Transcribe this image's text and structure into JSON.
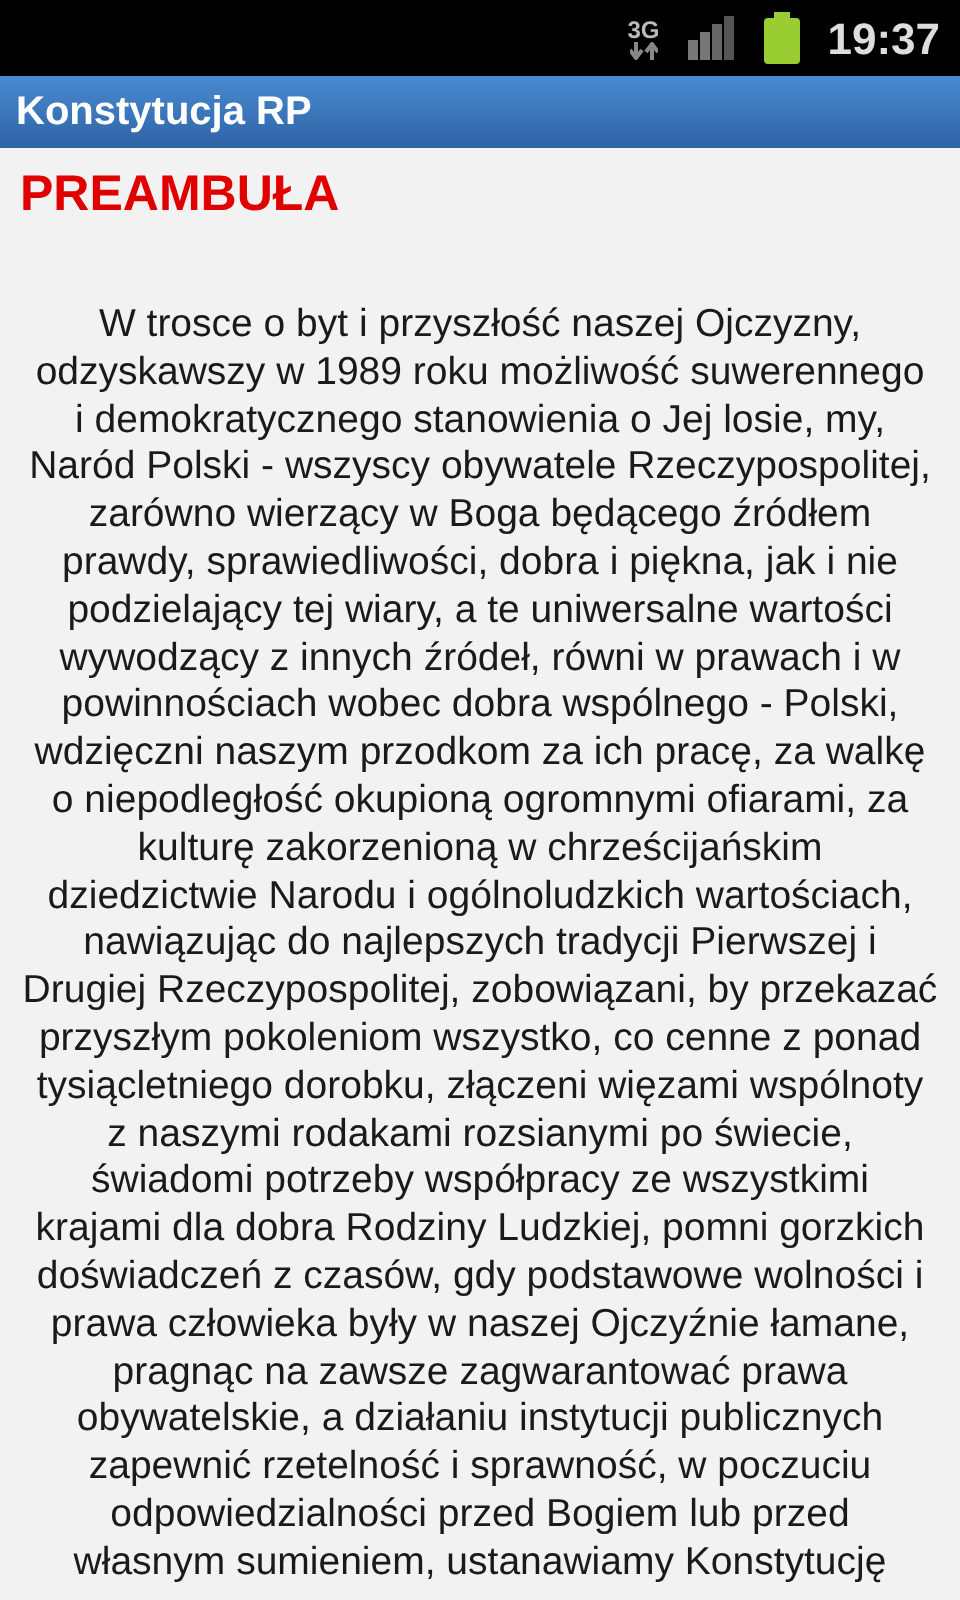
{
  "status_bar": {
    "network": "3G",
    "time": "19:37"
  },
  "window": {
    "title": "Konstytucja RP"
  },
  "heading": "PREAMBUŁA",
  "paragraph_lines": [
    "W trosce o byt i przyszłość naszej Ojczyzny,",
    "odzyskawszy w 1989 roku możliwość suwerennego",
    "i demokratycznego stanowienia o Jej losie, my,",
    "Naród Polski - wszyscy obywatele Rzeczypospolitej,",
    "zarówno wierzący w Boga będącego źródłem",
    "prawdy, sprawiedliwości, dobra i piękna, jak i nie",
    "podzielający tej wiary, a te uniwersalne wartości",
    "wywodzący z innych źródeł, równi w prawach i w",
    "powinnościach wobec dobra wspólnego - Polski,",
    "wdzięczni naszym przodkom za ich pracę, za walkę",
    "o niepodległość okupioną ogromnymi ofiarami, za",
    "kulturę zakorzenioną w chrześcijańskim",
    "dziedzictwie Narodu i ogólnoludzkich wartościach,",
    "nawiązując do najlepszych tradycji Pierwszej i",
    "Drugiej Rzeczypospolitej, zobowiązani, by przekazać",
    "przyszłym pokoleniom wszystko, co cenne z ponad",
    "tysiącletniego dorobku, złączeni więzami wspólnoty",
    "z naszymi rodakami rozsianymi po świecie,",
    "świadomi potrzeby współpracy ze wszystkimi",
    "krajami dla dobra Rodziny Ludzkiej, pomni gorzkich",
    "doświadczeń z czasów, gdy podstawowe wolności i",
    "prawa człowieka były w naszej Ojczyźnie łamane,",
    "pragnąc na zawsze zagwarantować prawa",
    "obywatelskie, a działaniu instytucji publicznych",
    "zapewnić rzetelność i sprawność, w poczuciu",
    "odpowiedzialności przed Bogiem lub przed",
    "własnym sumieniem, ustanawiamy Konstytucję"
  ]
}
